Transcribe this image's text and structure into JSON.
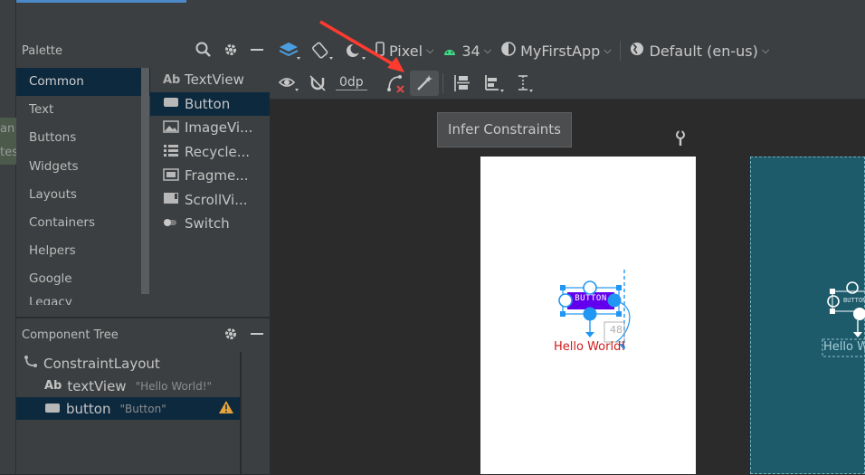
{
  "palette": {
    "title": "Palette",
    "categories": [
      "Common",
      "Text",
      "Buttons",
      "Widgets",
      "Layouts",
      "Containers",
      "Helpers",
      "Google",
      "Legacy"
    ],
    "items": [
      {
        "label": "TextView",
        "icon": "Ab"
      },
      {
        "label": "Button",
        "icon": "button-icon"
      },
      {
        "label": "ImageVi...",
        "icon": "image-icon"
      },
      {
        "label": "Recycle...",
        "icon": "list-icon"
      },
      {
        "label": "Fragme...",
        "icon": "fragment-icon"
      },
      {
        "label": "ScrollVi...",
        "icon": "scroll-icon"
      },
      {
        "label": "Switch",
        "icon": "switch-icon"
      }
    ]
  },
  "tree": {
    "title": "Component Tree",
    "root": "ConstraintLayout",
    "children": [
      {
        "id": "textView",
        "text": "\"Hello World!\"",
        "icon": "Ab"
      },
      {
        "id": "button",
        "text": "\"Button\""
      }
    ]
  },
  "toolbar": {
    "device": "Pixel",
    "api": "34",
    "theme": "MyFirstApp",
    "locale": "Default (en-us)",
    "margin": "0dp"
  },
  "tooltip": "Infer Constraints",
  "design": {
    "button_text": "BUTTON",
    "text": "Hello World!",
    "margin_label": "48",
    "blueprint_button": "BUTTON",
    "blueprint_text": "Hello W"
  },
  "leftpeek": [
    "an",
    "tes"
  ],
  "colors": {
    "accent": "#4a88c7",
    "selection": "#0d293e",
    "arrow": "#ff3b30",
    "button": "#6200ee",
    "handle": "#2196f3"
  }
}
